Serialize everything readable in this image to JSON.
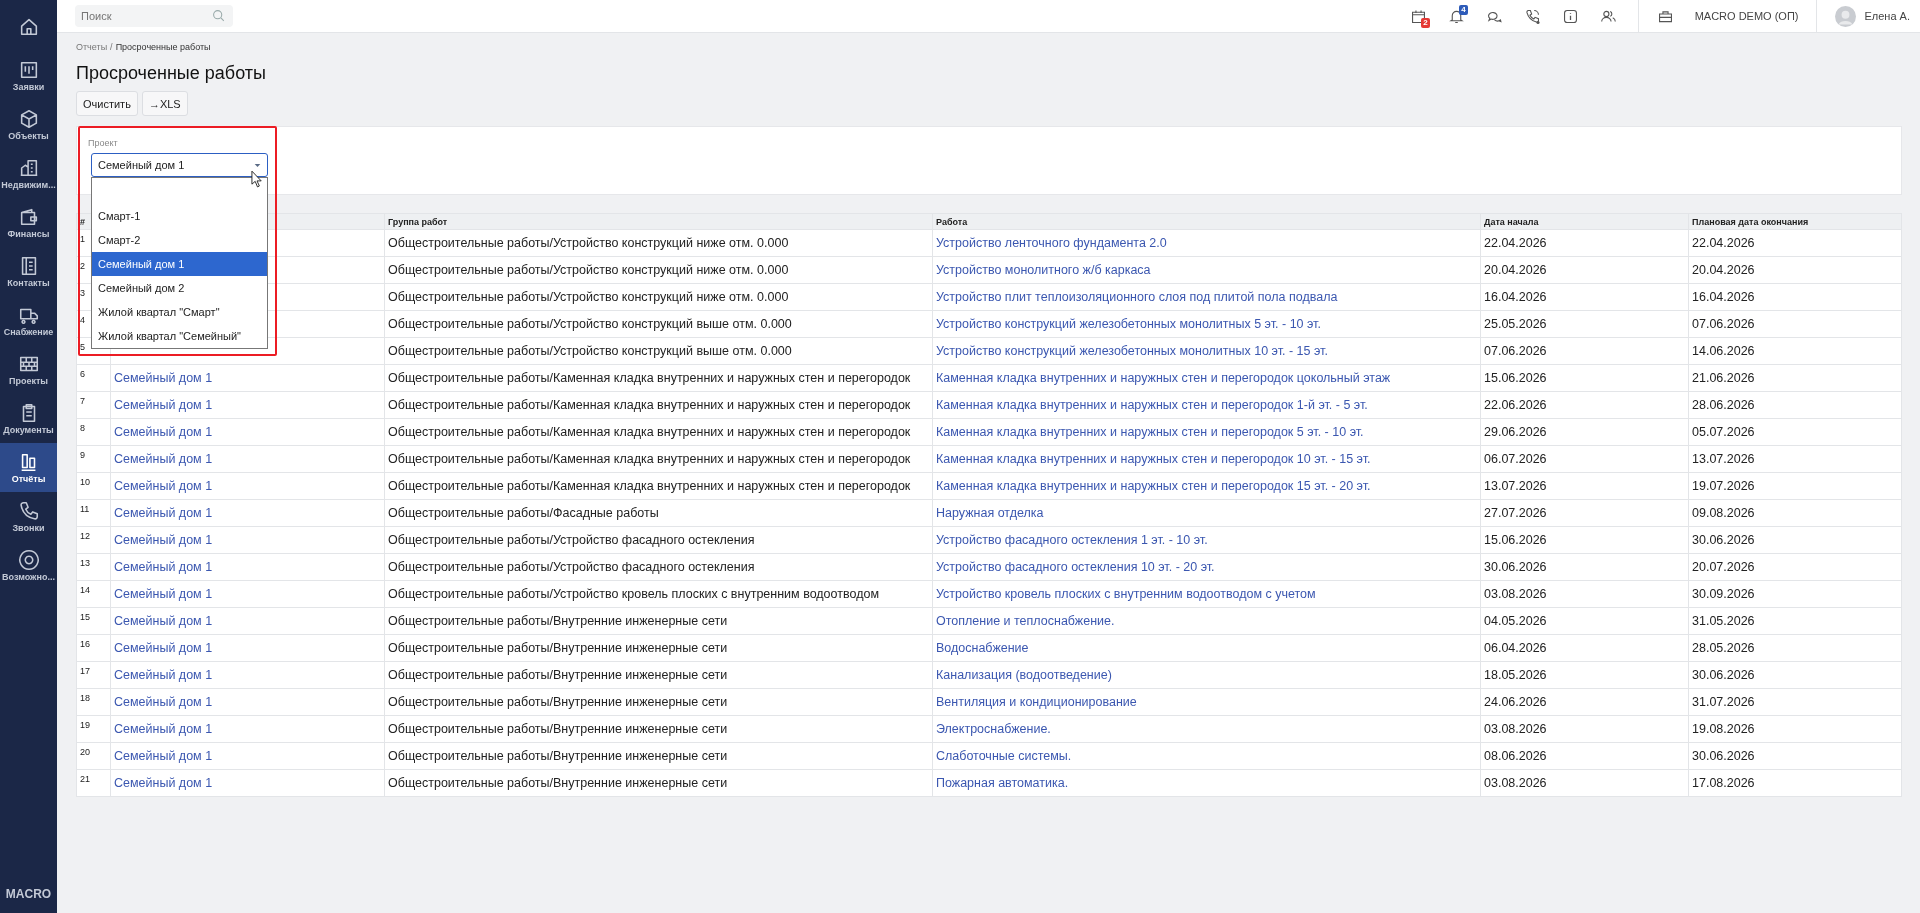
{
  "sidebar": {
    "items": [
      {
        "selected": false
      },
      {
        "label": "Заявки",
        "selected": false
      },
      {
        "label": "Объекты",
        "selected": false
      },
      {
        "label": "Недвижим...",
        "selected": false
      },
      {
        "label": "Финансы",
        "selected": false
      },
      {
        "label": "Контакты",
        "selected": false
      },
      {
        "label": "Снабжение",
        "selected": false
      },
      {
        "label": "Проекты",
        "selected": false
      },
      {
        "label": "Документы",
        "selected": false
      },
      {
        "label": "Отчёты",
        "selected": true
      },
      {
        "label": "Звонки",
        "selected": false
      },
      {
        "label": "Возможно...",
        "selected": false
      }
    ],
    "footer": "MACRO"
  },
  "topbar": {
    "search": {
      "placeholder": "Поиск"
    },
    "calendar_badge": "2",
    "notifications_badge": "4",
    "company": "MACRO DEMO (ОП)",
    "user": "Елена А."
  },
  "breadcrumb": {
    "items": [
      "Отчеты",
      "Просроченные работы"
    ],
    "separator": "/"
  },
  "title": "Просроченные работы",
  "buttons": [
    "Очистить",
    "→XLS"
  ],
  "filter": {
    "label": "Проект",
    "value": "Семейный дом 1",
    "options": [
      {
        "label": "Смарт-1",
        "selected": false
      },
      {
        "label": "Смарт-2",
        "selected": false
      },
      {
        "label": "Семейный дом 1",
        "selected": true
      },
      {
        "label": "Семейный дом 2",
        "selected": false
      },
      {
        "label": "Жилой квартал \"Смарт\"",
        "selected": false
      },
      {
        "label": "Жилой квартал \"Семейный\"",
        "selected": false
      }
    ]
  },
  "table": {
    "columns": [
      "#",
      "",
      "Группа работ",
      "Работа",
      "Дата начала",
      "Плановая дата окончания"
    ],
    "rows": [
      {
        "n": "1",
        "group": "Общестроительные работы/Устройство конструкций ниже отм. 0.000",
        "work": "Устройство ленточного фундамента 2.0",
        "start": "22.04.2026",
        "end": "22.04.2026"
      },
      {
        "n": "2",
        "group": "Общестроительные работы/Устройство конструкций ниже отм. 0.000",
        "work": "Устройство монолитного ж/б каркаса",
        "start": "20.04.2026",
        "end": "20.04.2026"
      },
      {
        "n": "3",
        "group": "Общестроительные работы/Устройство конструкций ниже отм. 0.000",
        "work": "Устройство плит теплоизоляционного слоя под плитой пола подвала",
        "start": "16.04.2026",
        "end": "16.04.2026"
      },
      {
        "n": "4",
        "group": "Общестроительные работы/Устройство конструкций выше отм. 0.000",
        "work": "Устройство конструкций железобетонных монолитных 5 эт. - 10 эт.",
        "start": "25.05.2026",
        "end": "07.06.2026"
      },
      {
        "n": "5",
        "group": "Общестроительные работы/Устройство конструкций выше отм. 0.000",
        "work": "Устройство конструкций железобетонных монолитных 10 эт. - 15 эт.",
        "start": "07.06.2026",
        "end": "14.06.2026"
      },
      {
        "n": "6",
        "project": "Семейный дом 1",
        "group": "Общестроительные работы/Каменная кладка внутренних и наружных стен и перегородок",
        "work": "Каменная кладка внутренних и наружных стен и перегородок цокольный этаж",
        "start": "15.06.2026",
        "end": "21.06.2026"
      },
      {
        "n": "7",
        "project": "Семейный дом 1",
        "group": "Общестроительные работы/Каменная кладка внутренних и наружных стен и перегородок",
        "work": "Каменная кладка внутренних и наружных стен и перегородок 1-й эт. - 5 эт.",
        "start": "22.06.2026",
        "end": "28.06.2026"
      },
      {
        "n": "8",
        "project": "Семейный дом 1",
        "group": "Общестроительные работы/Каменная кладка внутренних и наружных стен и перегородок",
        "work": "Каменная кладка внутренних и наружных стен и перегородок 5 эт. - 10 эт.",
        "start": "29.06.2026",
        "end": "05.07.2026"
      },
      {
        "n": "9",
        "project": "Семейный дом 1",
        "group": "Общестроительные работы/Каменная кладка внутренних и наружных стен и перегородок",
        "work": "Каменная кладка внутренних и наружных стен и перегородок 10 эт. - 15 эт.",
        "start": "06.07.2026",
        "end": "13.07.2026"
      },
      {
        "n": "10",
        "project": "Семейный дом 1",
        "group": "Общестроительные работы/Каменная кладка внутренних и наружных стен и перегородок",
        "work": "Каменная кладка внутренних и наружных стен и перегородок 15 эт. - 20 эт.",
        "start": "13.07.2026",
        "end": "19.07.2026"
      },
      {
        "n": "11",
        "project": "Семейный дом 1",
        "group": "Общестроительные работы/Фасадные работы",
        "work": "Наружная отделка",
        "start": "27.07.2026",
        "end": "09.08.2026"
      },
      {
        "n": "12",
        "project": "Семейный дом 1",
        "group": "Общестроительные работы/Устройство фасадного остекления",
        "work": "Устройство фасадного остекления 1 эт. - 10 эт.",
        "start": "15.06.2026",
        "end": "30.06.2026"
      },
      {
        "n": "13",
        "project": "Семейный дом 1",
        "group": "Общестроительные работы/Устройство фасадного остекления",
        "work": "Устройство фасадного остекления 10 эт. - 20 эт.",
        "start": "30.06.2026",
        "end": "20.07.2026"
      },
      {
        "n": "14",
        "project": "Семейный дом 1",
        "group": "Общестроительные работы/Устройство кровель плоских с внутренним водоотводом",
        "work": "Устройство кровель плоских с внутренним водоотводом с учетом",
        "start": "03.08.2026",
        "end": "30.09.2026"
      },
      {
        "n": "15",
        "project": "Семейный дом 1",
        "group": "Общестроительные работы/Внутренние инженерные сети",
        "work": "Отопление и теплоснабжение.",
        "start": "04.05.2026",
        "end": "31.05.2026"
      },
      {
        "n": "16",
        "project": "Семейный дом 1",
        "group": "Общестроительные работы/Внутренние инженерные сети",
        "work": "Водоснабжение",
        "start": "06.04.2026",
        "end": "28.05.2026"
      },
      {
        "n": "17",
        "project": "Семейный дом 1",
        "group": "Общестроительные работы/Внутренние инженерные сети",
        "work": "Канализация (водоотведение)",
        "start": "18.05.2026",
        "end": "30.06.2026"
      },
      {
        "n": "18",
        "project": "Семейный дом 1",
        "group": "Общестроительные работы/Внутренние инженерные сети",
        "work": "Вентиляция и кондиционирование",
        "start": "24.06.2026",
        "end": "31.07.2026"
      },
      {
        "n": "19",
        "project": "Семейный дом 1",
        "group": "Общестроительные работы/Внутренние инженерные сети",
        "work": "Электроснабжение.",
        "start": "03.08.2026",
        "end": "19.08.2026"
      },
      {
        "n": "20",
        "project": "Семейный дом 1",
        "group": "Общестроительные работы/Внутренние инженерные сети",
        "work": "Слаботочные системы.",
        "start": "08.06.2026",
        "end": "30.06.2026"
      },
      {
        "n": "21",
        "project": "Семейный дом 1",
        "group": "Общестроительные работы/Внутренние инженерные сети",
        "work": "Пожарная автоматика.",
        "start": "03.08.2026",
        "end": "17.08.2026"
      }
    ]
  }
}
